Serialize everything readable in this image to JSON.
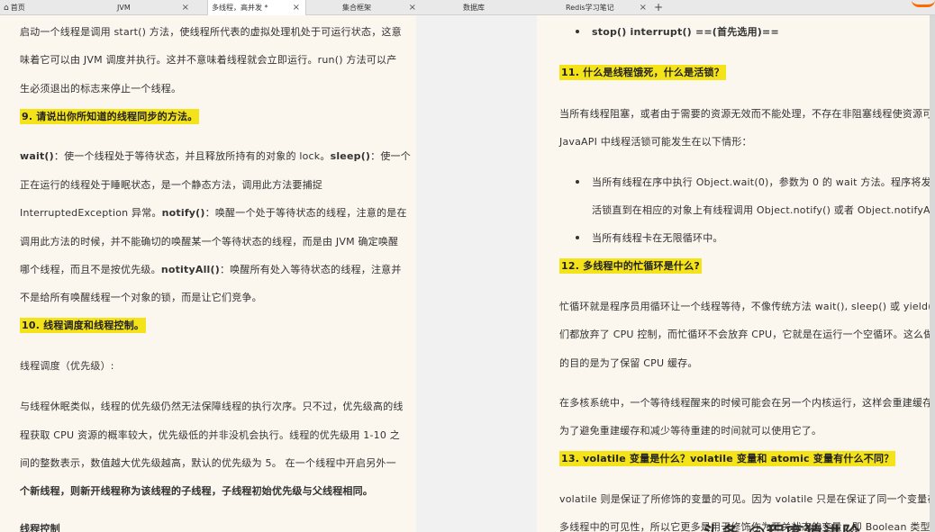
{
  "tabs": [
    {
      "label": "首页",
      "icon": "home-icon"
    },
    {
      "label": "JVM"
    },
    {
      "label": "多线程，高并发 *"
    },
    {
      "label": "集合框架"
    },
    {
      "label": "数据库"
    },
    {
      "label": "Redis学习笔记"
    }
  ],
  "tab_close_glyph": "×",
  "new_tab_glyph": "+",
  "left": {
    "l1": "启动一个线程是调用 start() 方法，使线程所代表的虚拟处理机处于可运行状态，这意",
    "l2": "味着它可以由 JVM 调度并执行。这并不意味着线程就会立即运行。run() 方法可以产",
    "l3": "生必须退出的标志来停止一个线程。",
    "h9": "9. 请说出你所知道的线程同步的方法。",
    "p1a_b": "wait()",
    "p1a_t": "：使一个线程处于等待状态，并且释放所持有的对象的 lock。",
    "p1a_b2": "sleep()",
    "p1a_t2": "：使一个",
    "p1b": "正在运行的线程处于睡眠状态，是一个静态方法，调用此方法要捕捉",
    "p1c_t": "InterruptedException 异常。",
    "p1c_b": "notify()",
    "p1c_t2": "：唤醒一个处于等待状态的线程，注意的是在",
    "p1d": "调用此方法的时候，并不能确切的唤醒某一个等待状态的线程，而是由 JVM 确定唤醒",
    "p1e_t": "哪个线程，而且不是按优先级。",
    "p1e_b": "notityAll()",
    "p1e_t2": "：唤醒所有处入等待状态的线程，注意并",
    "p1f": "不是给所有唤醒线程一个对象的锁，而是让它们竞争。",
    "h10": "10. 线程调度和线程控制。",
    "p2": "线程调度（优先级）:",
    "p3a": "与线程休眠类似，线程的优先级仍然无法保障线程的执行次序。只不过，优先级高的线",
    "p3b": "程获取 CPU 资源的概率较大，优先级低的并非没机会执行。线程的优先级用 1-10 之",
    "p3c": "间的整数表示，数值越大优先级越高，默认的优先级为 5。  在一个线程中开启另外一",
    "p3d": "个新线程，则新开线程称为该线程的子线程，子线程初始优先级与父线程相同。",
    "h_ctrl": "线程控制"
  },
  "right": {
    "r0": "stop() interrupt() ==(首先选用)==",
    "h11": "11. 什么是线程饿死，什么是活锁？",
    "q1": "当所有线程阻塞，或者由于需要的资源无效而不能处理，不存在非阻塞线程使资源可用。",
    "q2": "JavaAPI 中线程活锁可能发生在以下情形：",
    "b1a": "当所有线程在序中执行 Object.wait(0)，参数为 0 的 wait 方法。程序将发生",
    "b1b": "活锁直到在相应的对象上有线程调用 Object.notify() 或者 Object.notifyAll()",
    "b2": "当所有线程卡在无限循环中。",
    "h12": "12. 多线程中的忙循环是什么?",
    "q3a": "忙循环就是程序员用循环让一个线程等待，不像传统方法 wait(), sleep() 或 yield() 它",
    "q3b": "们都放弃了 CPU 控制，而忙循环不会放弃 CPU，它就是在运行一个空循环。这么做",
    "q3c": "的目的是为了保留 CPU 缓存。",
    "q4a": "在多核系统中，一个等待线程醒来的时候可能会在另一个内核运行，这样会重建缓存。",
    "q4b": "为了避免重建缓存和减少等待重建的时间就可以使用它了。",
    "h13": "13. volatile 变量是什么？volatile 变量和 atomic 变量有什么不同？",
    "q5a": "volatile 则是保证了所修饰的变量的可见。因为 volatile 只是在保证了同一个变量在",
    "q5b": "多线程中的可见性，所以它更多是用于修饰作为开关状态的变量，即 Boolean 类型的"
  },
  "watermark": "头条 @程序猿进阶"
}
